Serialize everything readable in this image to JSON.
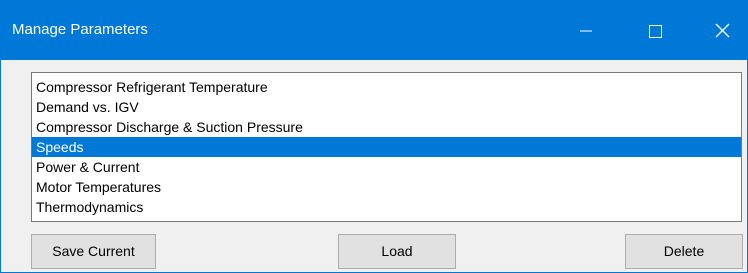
{
  "window": {
    "title": "Manage Parameters",
    "accent_color": "#0078d7",
    "caption_icons": [
      "minimize-icon",
      "maximize-icon",
      "close-icon"
    ]
  },
  "parameters_list": {
    "items": [
      "Compressor Refrigerant Temperature",
      "Demand vs. IGV",
      "Compressor Discharge & Suction Pressure",
      "Speeds",
      "Power & Current",
      "Motor Temperatures",
      "Thermodynamics"
    ],
    "selected": "Speeds"
  },
  "actions": {
    "save_label": "Save Current",
    "load_label": "Load",
    "delete_label": "Delete"
  }
}
